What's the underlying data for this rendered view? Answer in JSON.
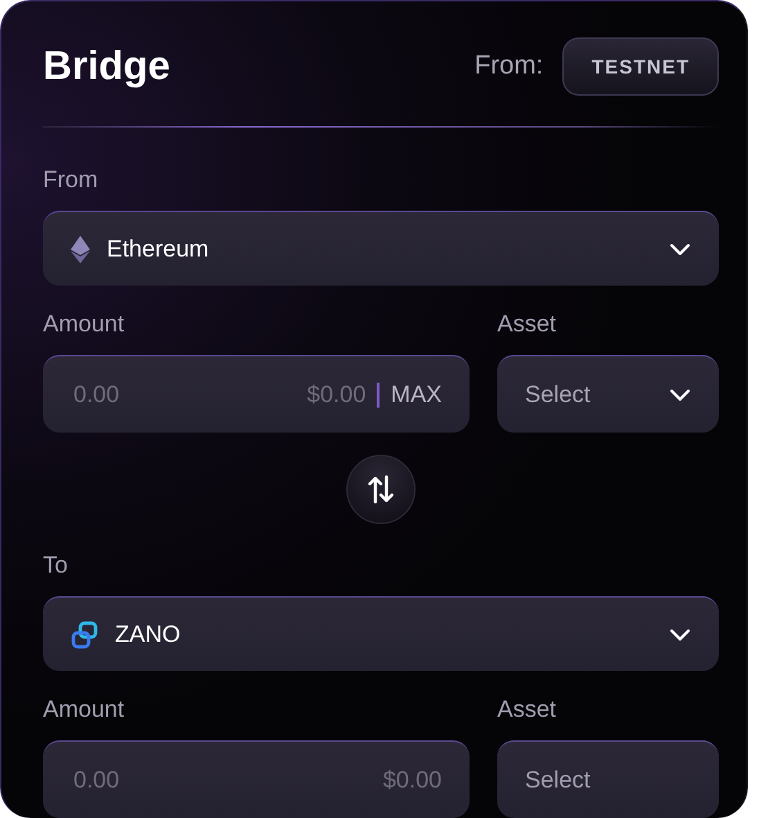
{
  "header": {
    "title": "Bridge",
    "network_label": "From:",
    "network_button": "TESTNET"
  },
  "sections": [
    {
      "network_label": "From",
      "network": {
        "name": "Ethereum",
        "kind": "ethereum"
      },
      "amount_label": "Amount",
      "amount_placeholder": "0.00",
      "usd": "$0.00",
      "max": "MAX",
      "asset_label": "Asset",
      "asset": {
        "placeholder": "Select",
        "disabled": false
      }
    },
    {
      "network_label": "To",
      "network": {
        "name": "ZANO",
        "kind": "zano"
      },
      "amount_label": "Amount",
      "amount_placeholder": "0.00",
      "usd": "$0.00",
      "asset_label": "Asset",
      "asset": {
        "placeholder": "Select",
        "disabled": true
      }
    }
  ]
}
